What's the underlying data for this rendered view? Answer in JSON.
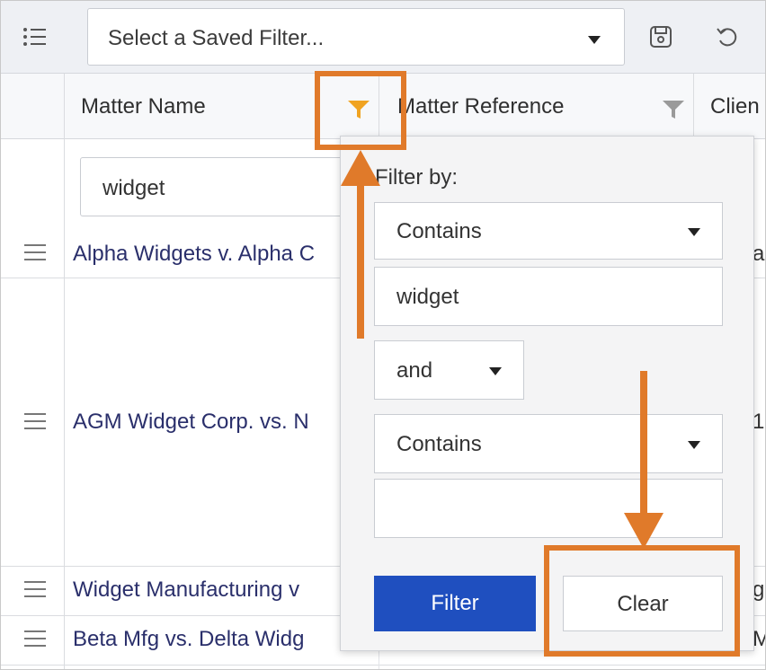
{
  "toolbar": {
    "saved_filter_placeholder": "Select a Saved Filter...",
    "icons": [
      "list-icon",
      "save-icon",
      "undo-icon"
    ]
  },
  "columns": [
    {
      "label": "Matter Name"
    },
    {
      "label": "Matter Reference"
    },
    {
      "label": "Clien"
    }
  ],
  "filter_row": {
    "matter_name_value": "widget"
  },
  "rows": [
    {
      "name": "Alpha Widgets v. Alpha C",
      "tail": "a"
    },
    {
      "name": "AGM Widget Corp. vs. N",
      "tail": "1"
    },
    {
      "name": "Widget Manufacturing v",
      "tail": "g"
    },
    {
      "name": "Beta Mfg vs. Delta Widg",
      "tail": "M"
    }
  ],
  "popup": {
    "title": "Filter by:",
    "condition1": "Contains",
    "value1": "widget",
    "join": "and",
    "condition2": "Contains",
    "value2": "",
    "filter_button": "Filter",
    "clear_button": "Clear"
  },
  "colors": {
    "accent": "#1f4fbf",
    "annotation": "#e07a2a",
    "active_filter_icon": "#f0a321",
    "link_text": "#2a2f6b"
  }
}
